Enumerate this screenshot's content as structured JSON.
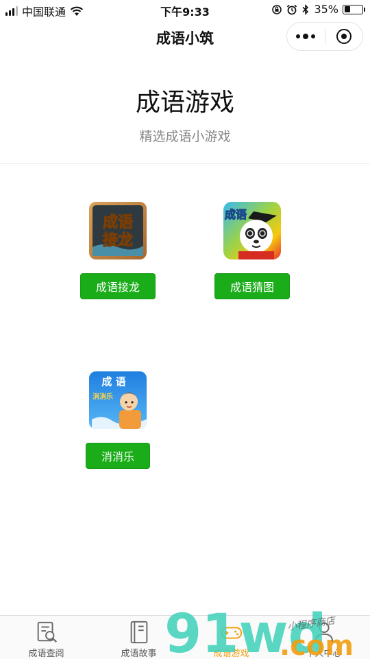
{
  "status_bar": {
    "carrier": "中国联通",
    "time": "下午9:33",
    "battery_percent": "35%",
    "battery_level": 0.35
  },
  "nav": {
    "title": "成语小筑"
  },
  "header": {
    "title": "成语游戏",
    "subtitle": "精选成语小游戏"
  },
  "games": [
    {
      "button_label": "成语接龙",
      "icon": "chengyu-jielong-icon",
      "icon_text": [
        "成语",
        "接龙"
      ]
    },
    {
      "button_label": "成语猜图",
      "icon": "chengyu-caitu-icon",
      "icon_text": "成语"
    },
    {
      "button_label": "消消乐",
      "icon": "xiaoxiaole-icon",
      "icon_text": [
        "成 语",
        "消消乐"
      ]
    }
  ],
  "tabs": [
    {
      "label": "成语查阅",
      "icon": "search-document-icon",
      "active": false
    },
    {
      "label": "成语故事",
      "icon": "book-icon",
      "active": false
    },
    {
      "label": "成语游戏",
      "icon": "gamepad-icon",
      "active": true
    },
    {
      "label": "个人中心",
      "icon": "person-icon",
      "active": false
    }
  ],
  "watermark": {
    "brand": "91wd",
    "suffix": ".com",
    "tagline": "小程序商店"
  },
  "colors": {
    "primary_green": "#1aad19",
    "active_tab": "#f29d0e",
    "subtitle_gray": "#888888"
  }
}
